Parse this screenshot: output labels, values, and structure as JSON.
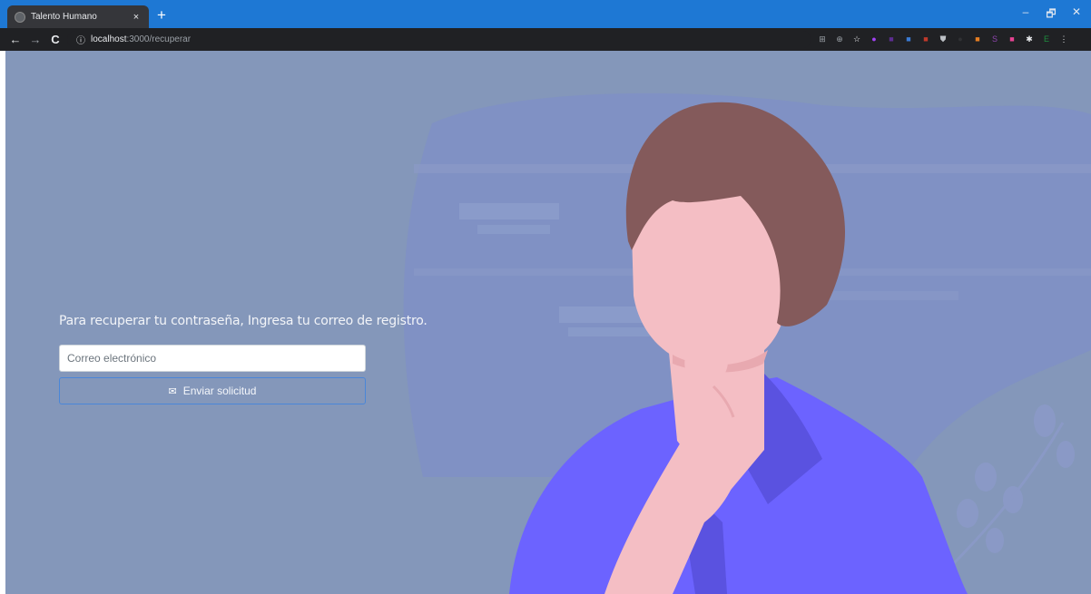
{
  "browser": {
    "tab_title": "Talento Humano",
    "tab_close": "×",
    "new_tab": "+",
    "url_host": "localhost",
    "url_path": ":3000/recuperar",
    "window_controls": [
      "–",
      "🗗",
      "✕"
    ],
    "nav": {
      "back": "←",
      "forward": "→",
      "reload": "C",
      "info": "ⓘ"
    },
    "extensions": [
      {
        "name": "translate-icon",
        "glyph": "⊞",
        "color": "#9aa0a6"
      },
      {
        "name": "zoom-icon",
        "glyph": "⊕",
        "color": "#9aa0a6"
      },
      {
        "name": "bookmark-star-icon",
        "glyph": "☆",
        "color": "#e8eaed"
      },
      {
        "name": "extension-purple-icon",
        "glyph": "●",
        "color": "#a142f4"
      },
      {
        "name": "extension-badge-icon",
        "glyph": "■",
        "color": "#5c2d91"
      },
      {
        "name": "extension-blue-icon",
        "glyph": "■",
        "color": "#3a7bd5"
      },
      {
        "name": "extension-red-icon",
        "glyph": "■",
        "color": "#c0392b"
      },
      {
        "name": "extension-shield-icon",
        "glyph": "⛊",
        "color": "#bdc1c6"
      },
      {
        "name": "extension-dark-icon",
        "glyph": "●",
        "color": "#303134"
      },
      {
        "name": "extension-orange-icon",
        "glyph": "■",
        "color": "#e67e22"
      },
      {
        "name": "extension-s-icon",
        "glyph": "S",
        "color": "#8e44ad"
      },
      {
        "name": "extension-pink-icon",
        "glyph": "■",
        "color": "#e84393"
      },
      {
        "name": "extensions-puzzle-icon",
        "glyph": "✱",
        "color": "#e8eaed"
      },
      {
        "name": "profile-e-icon",
        "glyph": "E",
        "color": "#1e8e3e"
      },
      {
        "name": "menu-kebab-icon",
        "glyph": "⋮",
        "color": "#e8eaed"
      }
    ]
  },
  "form": {
    "prompt": "Para recuperar tu contraseña, Ingresa tu correo de registro.",
    "email_placeholder": "Correo electrónico",
    "submit_label": "Enviar solicitud"
  },
  "colors": {
    "page_background": "#8497ba",
    "illustration_blob": "#7f8fc7",
    "hair": "#845a5b",
    "skin": "#f4bec4",
    "shirt": "#6c63ff",
    "shirt_shadow": "#5a52e0"
  }
}
